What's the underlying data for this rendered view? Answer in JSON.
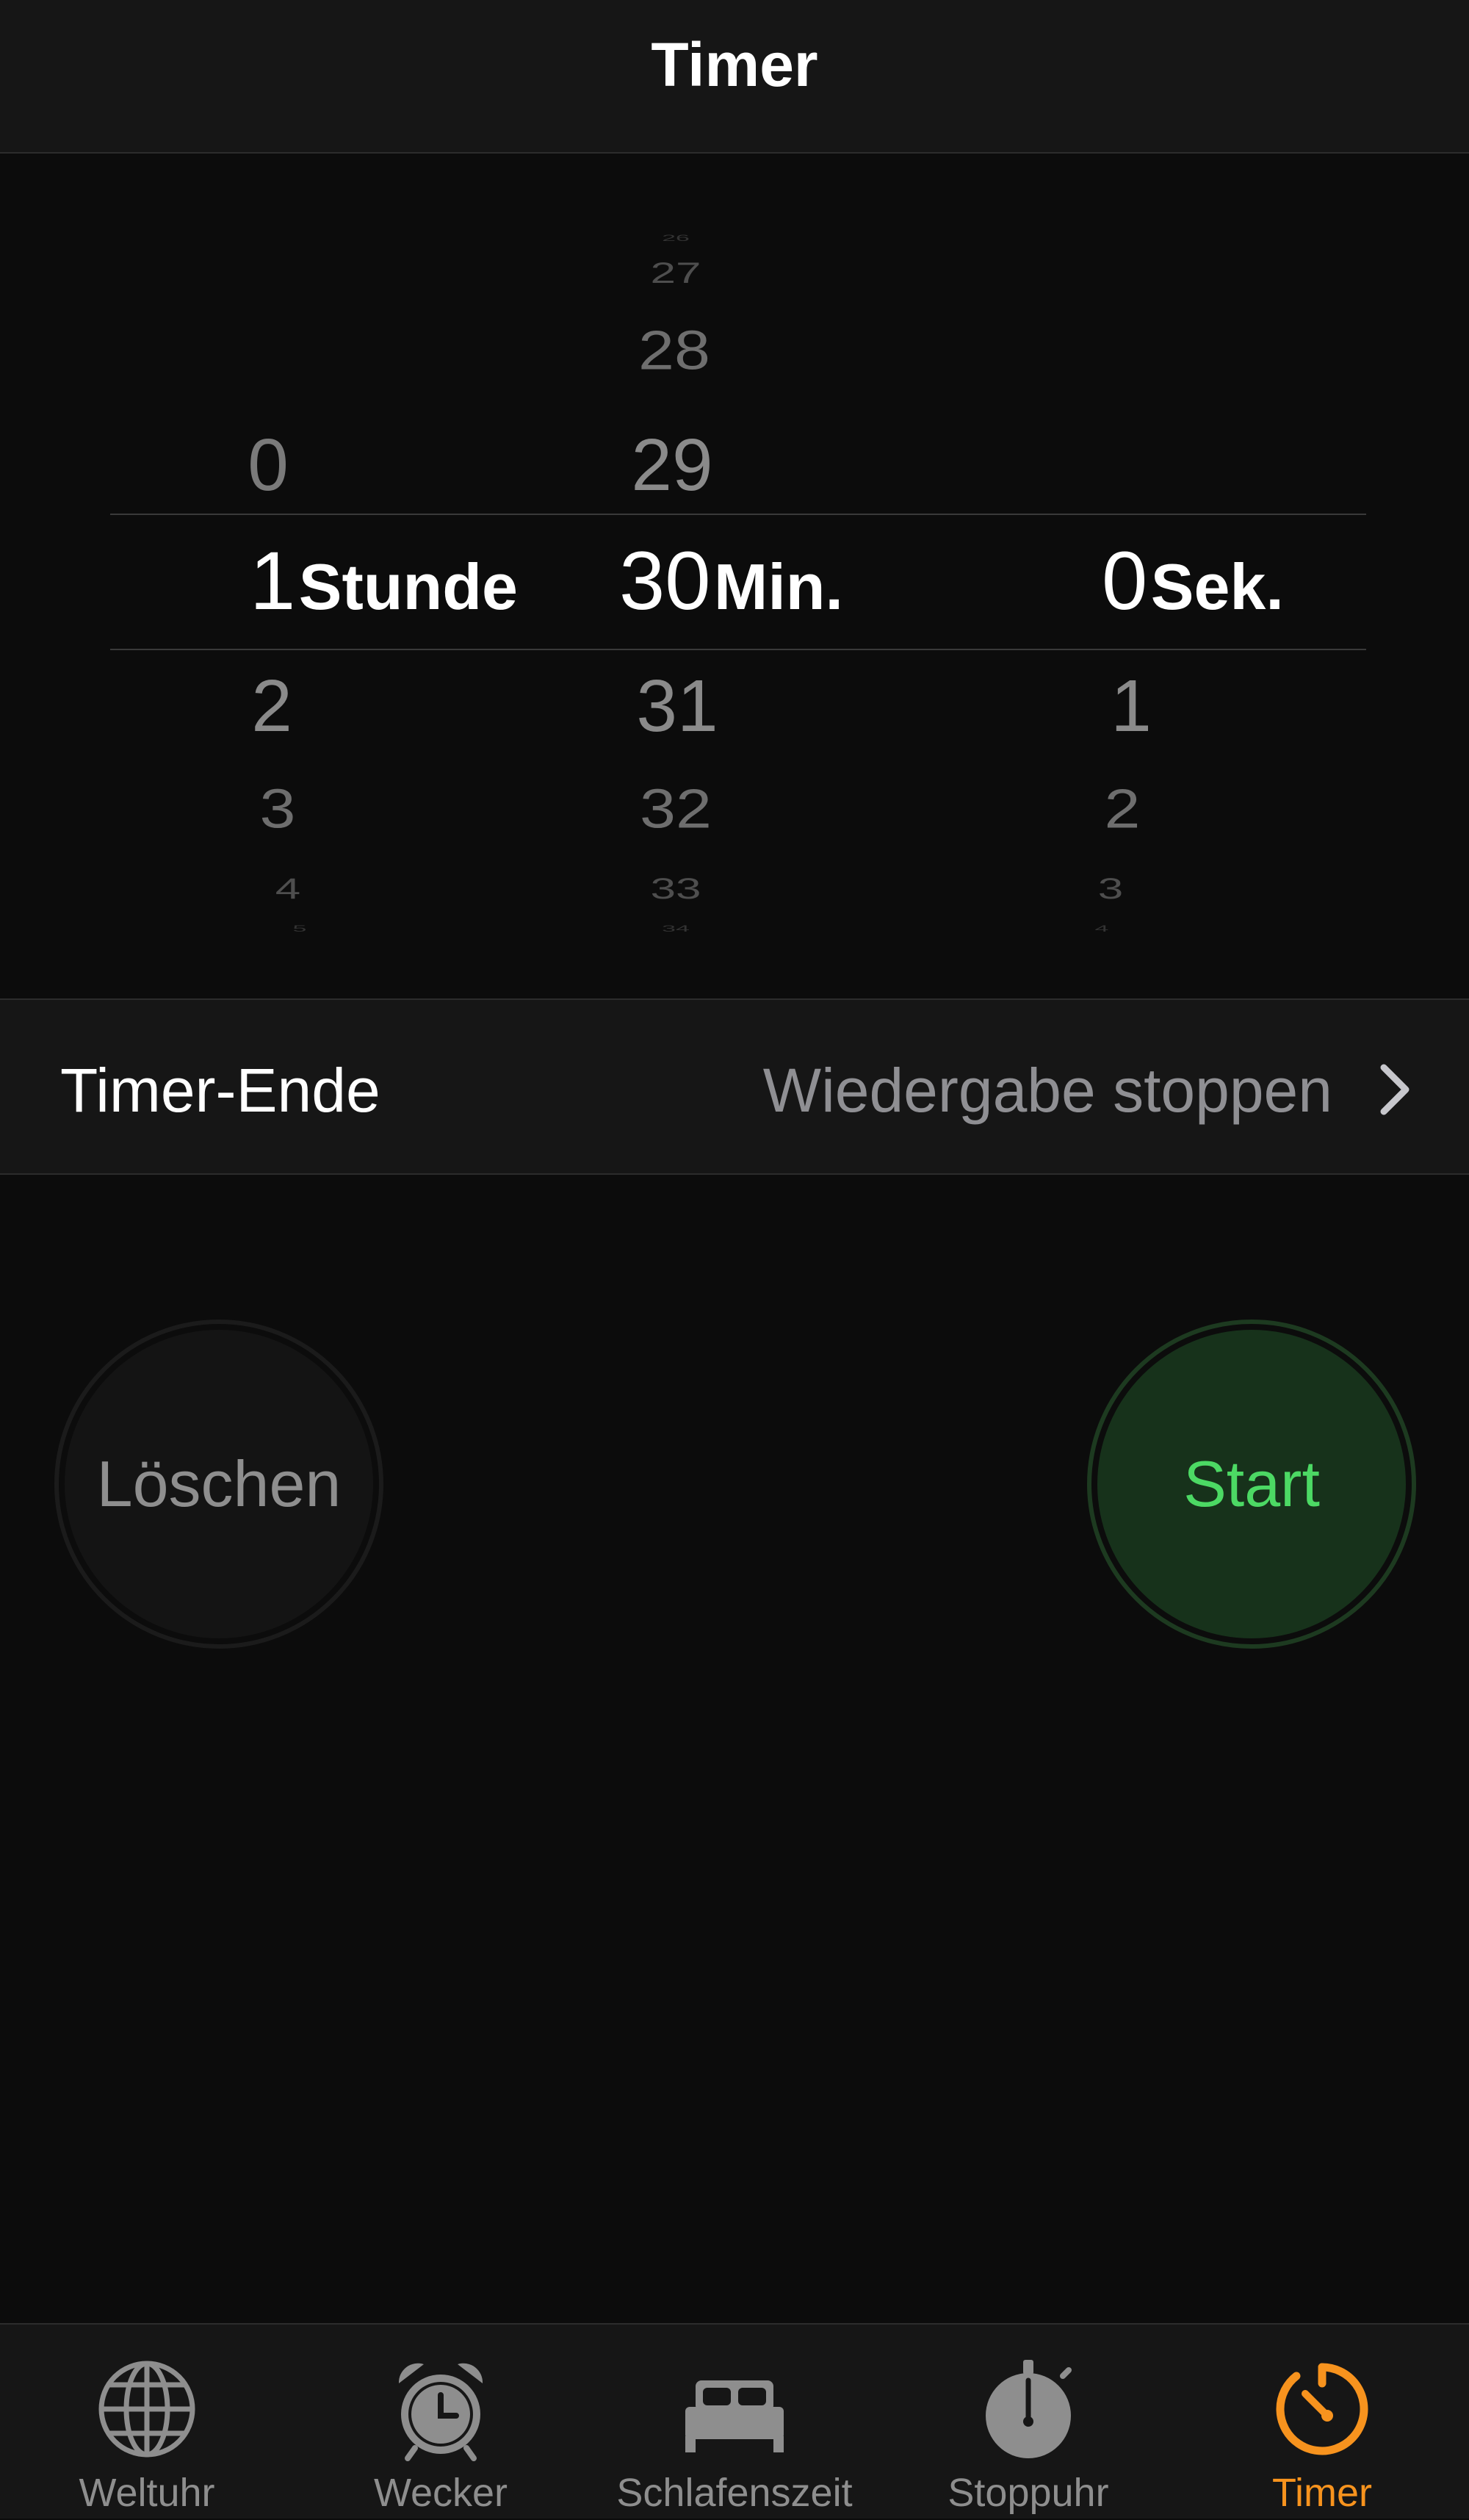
{
  "nav": {
    "title": "Timer"
  },
  "picker": {
    "hours": {
      "above": [
        "0"
      ],
      "selected": "1",
      "unit": "Stunde",
      "below": [
        "2",
        "3",
        "4",
        "5"
      ]
    },
    "minutes": {
      "above": [
        "26",
        "27",
        "28",
        "29"
      ],
      "selected": "30",
      "unit": "Min.",
      "below": [
        "31",
        "32",
        "33",
        "34"
      ]
    },
    "seconds": {
      "above": [],
      "selected": "0",
      "unit": "Sek.",
      "below": [
        "1",
        "2",
        "3",
        "4"
      ]
    }
  },
  "timer_end": {
    "label": "Timer-Ende",
    "value": "Wiedergabe stoppen"
  },
  "buttons": {
    "clear": "Löschen",
    "start": "Start"
  },
  "tabs": [
    {
      "label": "Weltuhr",
      "icon": "globe-icon"
    },
    {
      "label": "Wecker",
      "icon": "alarm-clock-icon"
    },
    {
      "label": "Schlafenszeit",
      "icon": "bed-icon"
    },
    {
      "label": "Stoppuhr",
      "icon": "stopwatch-icon"
    },
    {
      "label": "Timer",
      "icon": "timer-icon",
      "active": true
    }
  ],
  "colors": {
    "accent": "#f7931e",
    "start_green": "#4cd964",
    "start_bg": "#17321b",
    "background": "#0c0c0c",
    "bar": "#161616"
  }
}
